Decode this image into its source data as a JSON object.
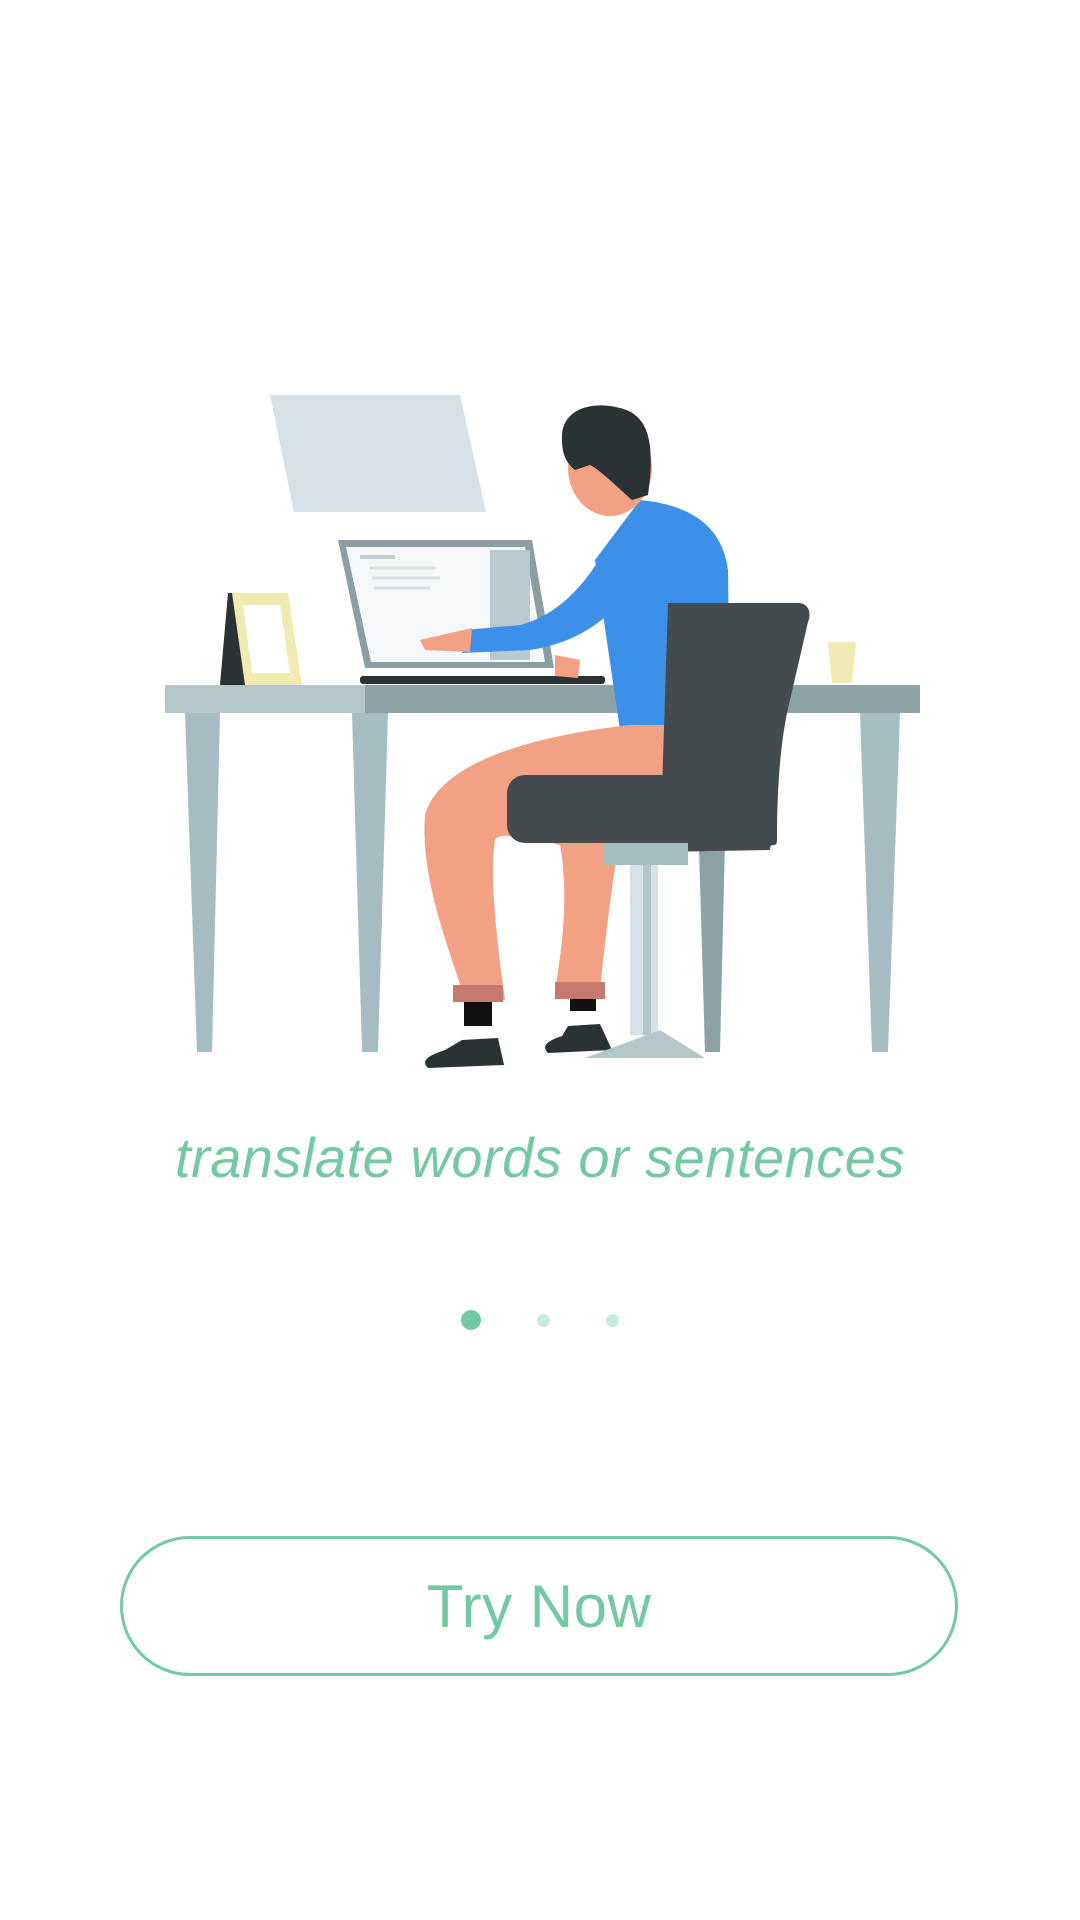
{
  "onboarding": {
    "tagline": "translate words or sentences",
    "page_indicator": {
      "total_pages": 3,
      "current_page": 1
    },
    "cta_button_label": "Try Now"
  },
  "illustration": {
    "icon": "person-at-desk-illustration"
  },
  "colors": {
    "accent": "#74c8a3",
    "accent_light": "#c9ebdc",
    "background": "#ffffff"
  }
}
